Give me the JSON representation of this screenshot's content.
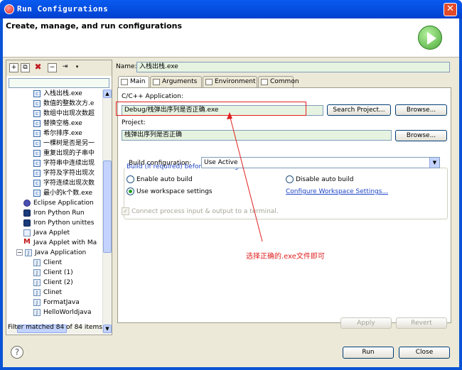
{
  "window": {
    "title": "Run Configurations",
    "close_label": "✕"
  },
  "banner": {
    "title": "Create, manage, and run configurations",
    "icon": "run-icon"
  },
  "left_toolbar": {
    "icons": [
      "new-configuration-icon",
      "duplicate-icon",
      "delete-icon",
      "collapse-all-icon",
      "filter-icon",
      "dropdown-arrow-icon"
    ]
  },
  "tree": {
    "items": [
      {
        "label": "入栈出栈.exe",
        "icon": "c-file-icon",
        "level": 2
      },
      {
        "label": "数值的整数次方.e",
        "icon": "c-file-icon",
        "level": 2
      },
      {
        "label": "数组中出现次数超",
        "icon": "c-file-icon",
        "level": 2
      },
      {
        "label": "替换空格.exe",
        "icon": "c-file-icon",
        "level": 2
      },
      {
        "label": "希尔排序.exe",
        "icon": "c-file-icon",
        "level": 2
      },
      {
        "label": "一棵树是否是另一",
        "icon": "c-file-icon",
        "level": 2
      },
      {
        "label": "重复出现的子串中",
        "icon": "c-file-icon",
        "level": 2
      },
      {
        "label": "字符串中连续出现",
        "icon": "c-file-icon",
        "level": 2
      },
      {
        "label": "字符及字符出现次",
        "icon": "c-file-icon",
        "level": 2
      },
      {
        "label": "字符连续出现次数",
        "icon": "c-file-icon",
        "level": 2
      },
      {
        "label": "最小的k个数.exe",
        "icon": "c-file-icon",
        "level": 2
      },
      {
        "label": "Eclipse Application",
        "icon": "eclipse-icon",
        "level": 1
      },
      {
        "label": "Iron Python Run",
        "icon": "python-icon",
        "level": 1
      },
      {
        "label": "Iron Python unittes",
        "icon": "python-icon",
        "level": 1
      },
      {
        "label": "Java Applet",
        "icon": "applet-icon",
        "level": 1
      },
      {
        "label": "Java Applet with Ma",
        "icon": "junit-icon",
        "level": 1
      },
      {
        "label": "Java Application",
        "icon": "java-app-icon",
        "level": 1,
        "expanded": true
      },
      {
        "label": "Client",
        "icon": "java-file-icon",
        "level": 2
      },
      {
        "label": "Client (1)",
        "icon": "java-file-icon",
        "level": 2
      },
      {
        "label": "Client (2)",
        "icon": "java-file-icon",
        "level": 2
      },
      {
        "label": "Clinet",
        "icon": "java-file-icon",
        "level": 2
      },
      {
        "label": "FormatJava",
        "icon": "java-file-icon",
        "level": 2
      },
      {
        "label": "HelloWorldjava",
        "icon": "java-file-icon",
        "level": 2
      }
    ],
    "filter_status": "Filter matched 84 of 84 items"
  },
  "config": {
    "name_label": "Name:",
    "name_value": "入栈出栈.exe",
    "tabs": [
      "Main",
      "Arguments",
      "Environment",
      "Common"
    ],
    "active_tab": "Main",
    "app_label": "C/C++ Application:",
    "app_value": "Debug/栈弹出序列是否正确.exe",
    "search_project_label": "Search Project...",
    "browse_label": "Browse...",
    "project_label": "Project:",
    "project_value": "栈弹出序列是否正确",
    "build_group_title": "Build (if required) before launching",
    "build_config_label": "Build configuration:",
    "build_config_value": "Use Active",
    "radio_enable_auto": "Enable auto build",
    "radio_disable_auto": "Disable auto build",
    "radio_workspace": "Use workspace settings",
    "workspace_link": "Configure Workspace Settings...",
    "connect_terminal": "Connect process input & output to a terminal.",
    "apply_label": "Apply",
    "revert_label": "Revert"
  },
  "annotation": {
    "text": "选择正确的.exe文件即可",
    "color": "#e02020"
  },
  "footer": {
    "run_label": "Run",
    "close_label": "Close",
    "help_label": "?"
  }
}
